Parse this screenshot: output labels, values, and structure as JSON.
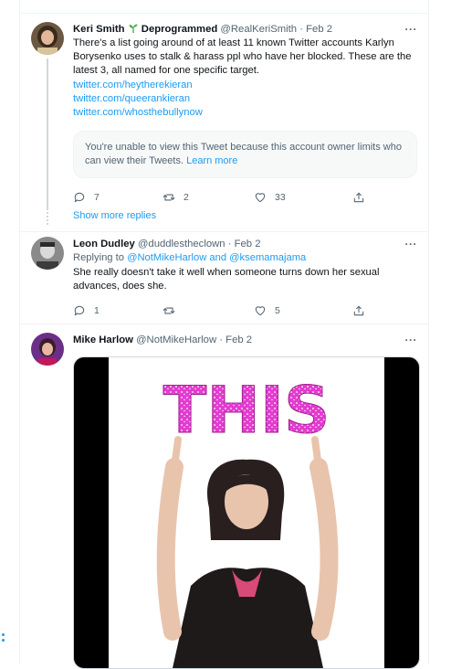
{
  "tweets": [
    {
      "author_name": "Keri Smith",
      "badge": "Deprogrammed",
      "handle": "@RealKeriSmith",
      "date": "· Feb 2",
      "text": "There's a list going around of at least 11 known Twitter accounts Karlyn Borysenko uses to stalk & harass ppl who have her blocked. These are the latest 3, all named for one specific target.",
      "links": [
        "twitter.com/heytherekieran",
        "twitter.com/queerankieran",
        "twitter.com/whosthebullynow"
      ],
      "notice_text": "You're unable to view this Tweet because this account owner limits who can view their Tweets.",
      "notice_link": "Learn more",
      "replies": "7",
      "retweets": "2",
      "likes": "33"
    },
    {
      "author_name": "Leon Dudley",
      "handle": "@duddlestheclown",
      "date": "· Feb 2",
      "replying_prefix": "Replying to",
      "replying_to": "@NotMikeHarlow and @ksemamajama",
      "text": "She really doesn't take it well when someone turns down her sexual advances, does she.",
      "replies": "1",
      "retweets": "",
      "likes": "5"
    },
    {
      "author_name": "Mike Harlow",
      "handle": "@NotMikeHarlow",
      "date": "· Feb 2",
      "gif_text": "THIS"
    }
  ],
  "show_more_replies": "Show more replies",
  "colors": {
    "accent": "#1d9bf0",
    "muted": "#536471",
    "gif_pink": "#e23bd0"
  }
}
